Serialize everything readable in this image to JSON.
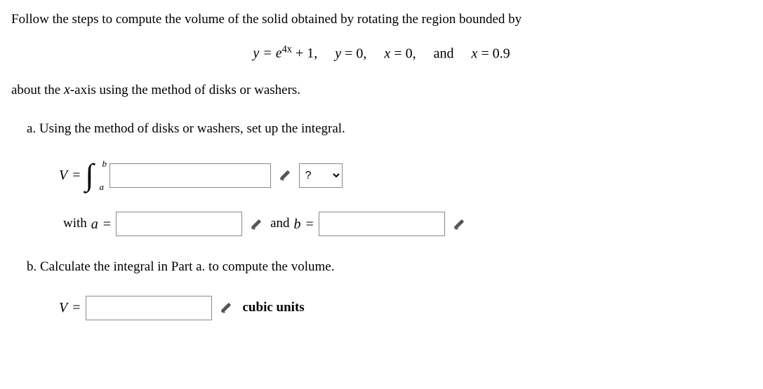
{
  "intro": "Follow the steps to compute the volume of the solid obtained by rotating the region bounded by",
  "equation": {
    "y_eq": "y = e",
    "exp": "4x",
    "plus": " + 1,",
    "y0": "y = 0,",
    "x0": "x = 0,",
    "and": "and",
    "x09": "x = 0.9"
  },
  "about": "about the ",
  "about_x": "x",
  "about_rest": "-axis using the method of disks or washers.",
  "part_a": {
    "label": "a. Using the method of disks or washers, set up the integral.",
    "V": "V",
    "int_a": "a",
    "int_b": "b",
    "select_placeholder": "?",
    "with": "with ",
    "a_var": "a",
    "and_b": " and ",
    "b_var": "b"
  },
  "part_b": {
    "label": "b. Calculate the integral in Part a. to compute the volume.",
    "V": "V",
    "units": "cubic units"
  }
}
